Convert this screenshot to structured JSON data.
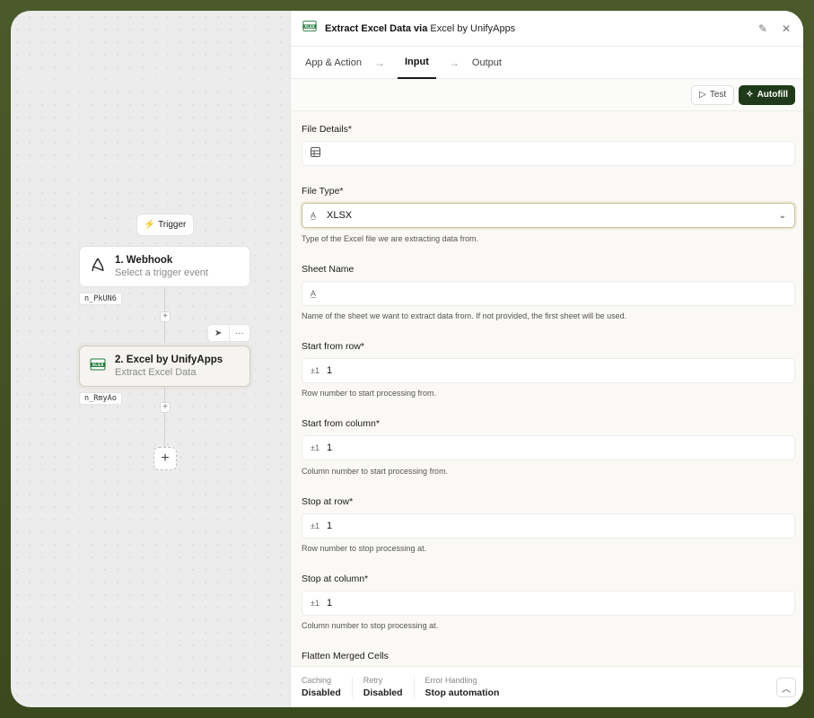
{
  "canvas": {
    "trigger_chip": "Trigger",
    "nodes": [
      {
        "title": "1. Webhook",
        "subtitle": "Select a trigger event",
        "id": "n_PkUN6"
      },
      {
        "title": "2. Excel by UnifyApps",
        "subtitle": "Extract Excel Data",
        "id": "n_RmyAo"
      }
    ],
    "add_symbol": "+",
    "node_action_more": "···"
  },
  "panel": {
    "title_bold": "Extract Excel Data via",
    "title_app": "Excel by UnifyApps",
    "icon_label": "XLSX",
    "tabs": [
      "App & Action",
      "Input",
      "Output"
    ],
    "active_tab": "Input",
    "toolbar": {
      "test": "Test",
      "autofill": "Autofill"
    },
    "fields": {
      "file_details": {
        "label": "File Details*",
        "value": ""
      },
      "file_type": {
        "label": "File Type*",
        "value": "XLSX",
        "help": "Type of the Excel file we are extracting data from."
      },
      "sheet_name": {
        "label": "Sheet Name",
        "value": "",
        "help": "Name of the sheet we want to extract data from. If not provided, the first sheet will be used."
      },
      "start_row": {
        "label": "Start from row*",
        "prefix": "±1",
        "value": "1",
        "help": "Row number to start processing from."
      },
      "start_col": {
        "label": "Start from column*",
        "prefix": "±1",
        "value": "1",
        "help": "Column number to start processing from."
      },
      "stop_row": {
        "label": "Stop at row*",
        "prefix": "±1",
        "value": "1",
        "help": "Row number to stop processing at."
      },
      "stop_col": {
        "label": "Stop at column*",
        "prefix": "±1",
        "value": "1",
        "help": "Column number to stop processing at."
      },
      "flatten": {
        "label": "Flatten Merged Cells"
      }
    },
    "footer": {
      "caching": {
        "label": "Caching",
        "value": "Disabled"
      },
      "retry": {
        "label": "Retry",
        "value": "Disabled"
      },
      "error": {
        "label": "Error Handling",
        "value": "Stop automation"
      }
    }
  },
  "colors": {
    "autofill_bg": "#1f3a1a",
    "frame_bg": "#4a5a2a",
    "xlsx_green": "#1d7a3a"
  }
}
